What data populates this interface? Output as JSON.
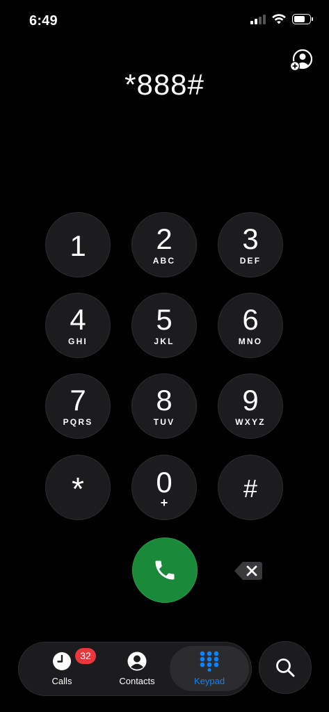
{
  "status_bar": {
    "time": "6:49"
  },
  "display": {
    "number": "*888#"
  },
  "keypad": {
    "keys": [
      {
        "digit": "1",
        "letters": ""
      },
      {
        "digit": "2",
        "letters": "ABC"
      },
      {
        "digit": "3",
        "letters": "DEF"
      },
      {
        "digit": "4",
        "letters": "GHI"
      },
      {
        "digit": "5",
        "letters": "JKL"
      },
      {
        "digit": "6",
        "letters": "MNO"
      },
      {
        "digit": "7",
        "letters": "PQRS"
      },
      {
        "digit": "8",
        "letters": "TUV"
      },
      {
        "digit": "9",
        "letters": "WXYZ"
      },
      {
        "digit": "*",
        "letters": ""
      },
      {
        "digit": "0",
        "letters": "+"
      },
      {
        "digit": "#",
        "letters": ""
      }
    ]
  },
  "tabs": {
    "calls": {
      "label": "Calls",
      "badge": "32"
    },
    "contacts": {
      "label": "Contacts"
    },
    "keypad": {
      "label": "Keypad"
    }
  },
  "icons": {
    "add_contact": "add-contact-icon",
    "call": "phone-icon",
    "backspace": "backspace-icon",
    "calls": "clock-icon",
    "contacts": "person-icon",
    "keypad": "keypad-grid-icon",
    "search": "search-icon"
  },
  "colors": {
    "call_green": "#1a8a3a",
    "accent_blue": "#0a84ff",
    "badge_red": "#e8383d",
    "key_background": "#1c1c1e"
  }
}
